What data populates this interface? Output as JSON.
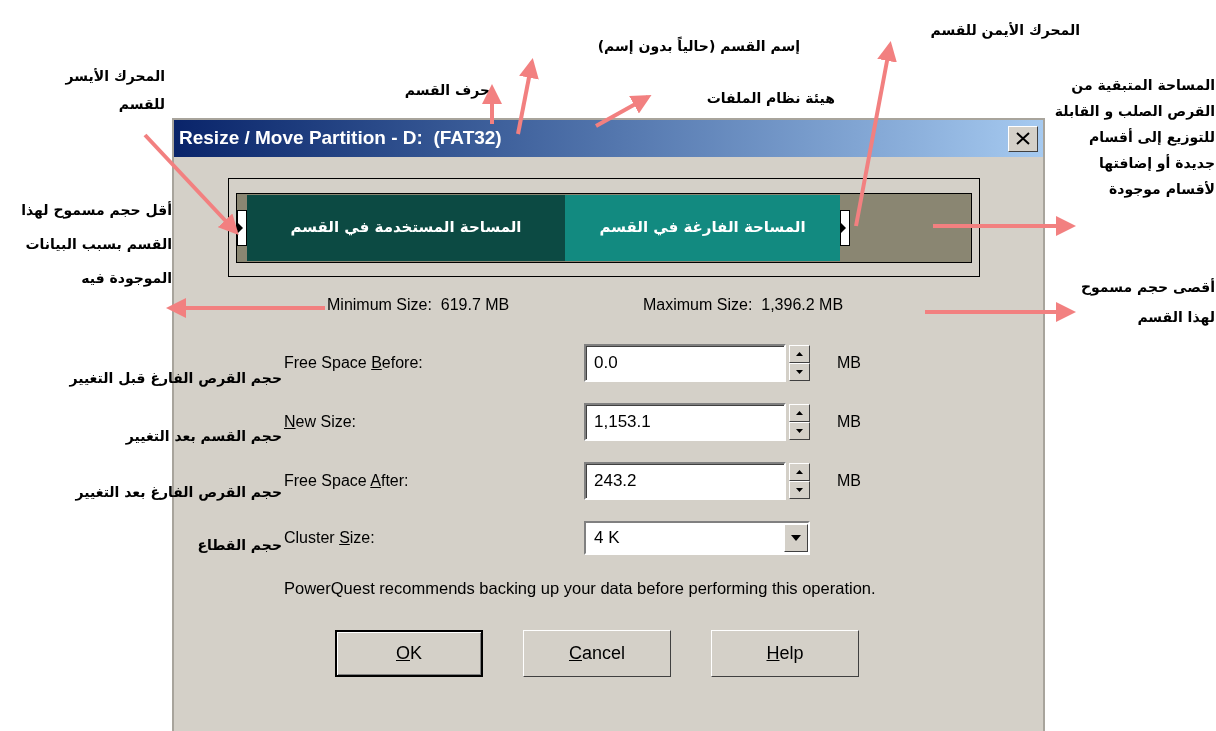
{
  "dialog": {
    "title": "Resize / Move Partition - D:  (FAT32)",
    "partition_bar": {
      "used_space": {
        "label": "المساحة المستخدمة في القسم"
      },
      "free_space": {
        "label": "المساحة الفارغة في القسم"
      }
    },
    "min_size": {
      "label": "Minimum Size:",
      "value": "619.7 MB"
    },
    "max_size": {
      "label": "Maximum Size:",
      "value": "1,396.2 MB"
    },
    "fields": [
      {
        "kind": "spin",
        "label": {
          "before": "Free Space ",
          "key": "B",
          "after": "efore:"
        },
        "value": "0.0",
        "unit": "MB",
        "annotation": "حجم القرص الفارغ قبل التغيير"
      },
      {
        "kind": "spin",
        "label": {
          "key": "N",
          "after": "ew Size:"
        },
        "value": "1,153.1",
        "unit": "MB",
        "annotation": "حجم القسم بعد التغيير"
      },
      {
        "kind": "spin",
        "label": {
          "before": "Free Space ",
          "key": "A",
          "after": "fter:"
        },
        "value": "243.2",
        "unit": "MB",
        "annotation": "حجم القرص الفارغ بعد التغيير"
      },
      {
        "kind": "dropdown",
        "label": {
          "before": "Cluster ",
          "key": "S",
          "after": "ize:"
        },
        "value": "4 K",
        "annotation": "حجم القطاع"
      }
    ],
    "note": "PowerQuest recommends backing up your data before performing this operation.",
    "ok_button": {
      "key": "O",
      "after": "K",
      "default": true
    },
    "cancel_button": {
      "key": "C",
      "after": "ancel",
      "default": false
    },
    "help_button": {
      "key": "H",
      "after": "elp",
      "default": false
    }
  },
  "annotations": {
    "left_handle": "المحرك الأيسر للقسم",
    "drive_letter": "حرف القسم",
    "partition_name": "إسم القسم (حالياً بدون إسم)",
    "file_system": "هيئة نظام الملفات",
    "right_handle": "المحرك الأيمن للقسم",
    "unallocated_space": "المساحة المتبقية من القرص الصلب و القابلة للتوزيع إلى أقسام جديدة أو إضافتها لأقسام موجودة",
    "minimum_size": "أقل حجم مسموح لهذا القسم بسبب البيانات الموجودة فيه",
    "maximum_size": "أقصى حجم مسموح لهذا القسم"
  }
}
